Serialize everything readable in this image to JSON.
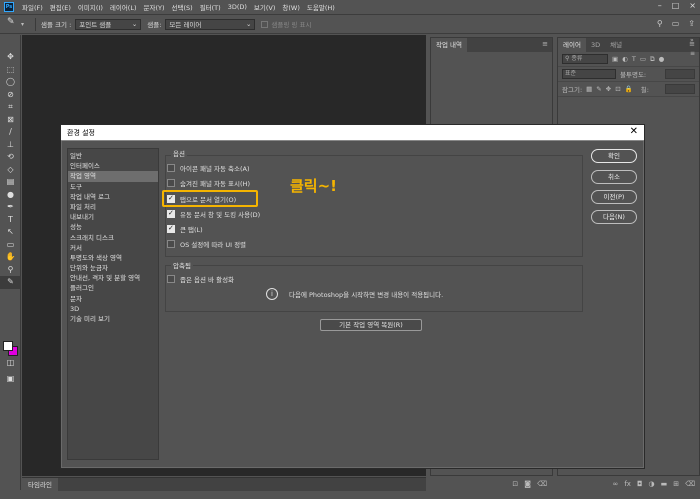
{
  "menubar": {
    "logo": "Ps",
    "items": [
      "파일(F)",
      "편집(E)",
      "이미지(I)",
      "레이어(L)",
      "문자(Y)",
      "선택(S)",
      "필터(T)",
      "3D(D)",
      "보기(V)",
      "창(W)",
      "도움말(H)"
    ]
  },
  "optionsbar": {
    "sample_size_label": "샘플 크기 :",
    "sample_size_value": "포인트 샘플",
    "sample_label": "샘플:",
    "sample_value": "모든 레이어",
    "show_ring_label": "샘플링 링 표시"
  },
  "history_panel": {
    "tab": "작업 내역"
  },
  "layers_panel": {
    "tabs": [
      "레이어",
      "3D",
      "채널"
    ],
    "search_placeholder": "종류",
    "blend_mode": "표준",
    "opacity_label": "불투명도:",
    "lock_label": "잠그기:",
    "fill_label": "칠:"
  },
  "timeline": {
    "tab": "타임라인"
  },
  "dialog": {
    "title": "환경 설정",
    "categories": [
      "일반",
      "인터페이스",
      "작업 영역",
      "도구",
      "작업 내역 로그",
      "파일 처리",
      "내보내기",
      "성능",
      "스크래치 디스크",
      "커서",
      "투명도와 색상 영역",
      "단위와 눈금자",
      "안내선, 격자 및 분할 영역",
      "플러그인",
      "문자",
      "3D",
      "기술 미리 보기"
    ],
    "selected_category": 2,
    "options_group_title": "옵션",
    "options": [
      {
        "label": "아이콘 패널 자동 축소(A)",
        "checked": false
      },
      {
        "label": "숨겨진 패널 자동 표시(H)",
        "checked": false
      },
      {
        "label": "탭으로 문서 열기(O)",
        "checked": true
      },
      {
        "label": "유동 문서 창 및 도킹 사용(D)",
        "checked": true
      },
      {
        "label": "큰 탭(L)",
        "checked": true
      },
      {
        "label": "OS 설정에 따라 UI 정렬",
        "checked": false
      }
    ],
    "compressed_group_title": "압축됨",
    "compressed_option": {
      "label": "좁은 옵션 바 활성화",
      "checked": false
    },
    "info_text": "다음에 Photoshop을 시작하면 변경 내용이 적용됩니다.",
    "reset_button": "기본 작업 영역 복원(R)",
    "buttons": {
      "ok": "확인",
      "cancel": "취소",
      "prev": "이전(P)",
      "next": "다음(N)"
    },
    "annotation": "클릭~!"
  },
  "colors": {
    "foreground": "#ffffff",
    "background": "#e000e0",
    "annotation": "#f5b400",
    "ui_bg": "#535353",
    "canvas_bg": "#282828"
  }
}
